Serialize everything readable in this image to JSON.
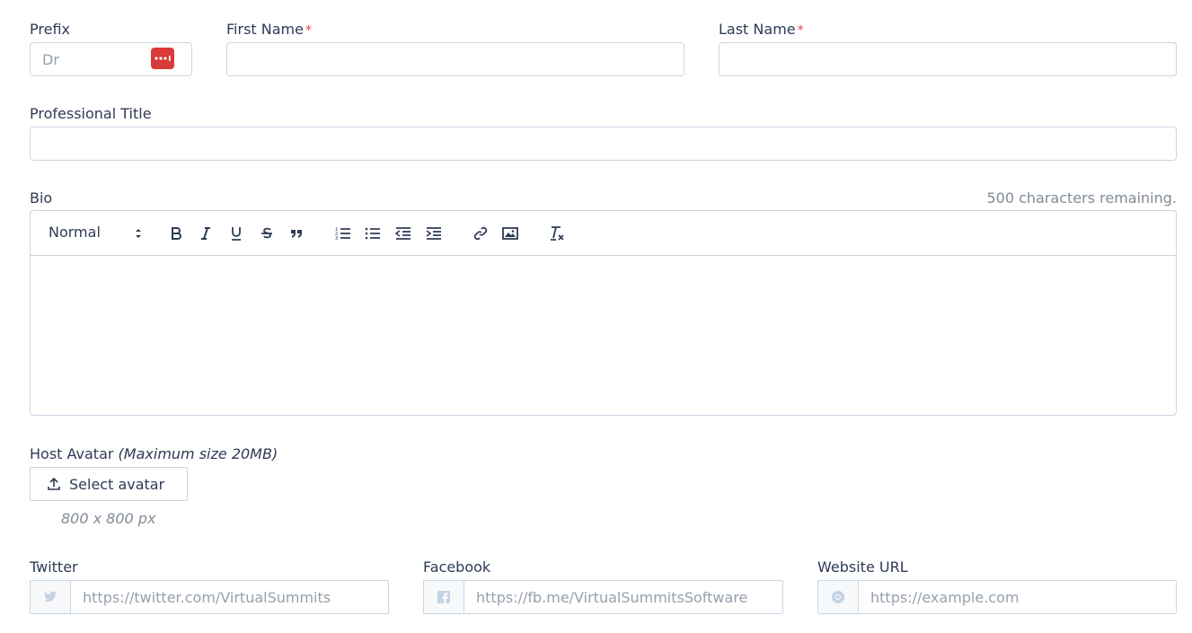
{
  "prefix": {
    "label": "Prefix",
    "placeholder": "Dr"
  },
  "first_name": {
    "label": "First Name",
    "required_mark": "*",
    "value": ""
  },
  "last_name": {
    "label": "Last Name",
    "required_mark": "*",
    "value": ""
  },
  "professional_title": {
    "label": "Professional Title",
    "value": ""
  },
  "bio": {
    "label": "Bio",
    "remaining": "500 characters remaining.",
    "toolbar": {
      "header_select": "Normal",
      "icons": [
        "bold-icon",
        "italic-icon",
        "underline-icon",
        "strike-icon",
        "blockquote-icon",
        "ordered-list-icon",
        "bullet-list-icon",
        "outdent-icon",
        "indent-icon",
        "link-icon",
        "image-icon",
        "clear-format-icon"
      ]
    },
    "value": ""
  },
  "avatar": {
    "label": "Host Avatar",
    "hint": "(Maximum size 20MB)",
    "button_label": "Select avatar",
    "size_note": "800 x 800 px"
  },
  "social": {
    "twitter": {
      "label": "Twitter",
      "placeholder": "https://twitter.com/VirtualSummits"
    },
    "facebook": {
      "label": "Facebook",
      "placeholder": "https://fb.me/VirtualSummitsSoftware"
    },
    "website": {
      "label": "Website URL",
      "placeholder": "https://example.com"
    }
  },
  "colors": {
    "border": "#c9d6e3",
    "required": "#e53e4b",
    "text": "#2e3a55",
    "muted": "#818a96",
    "password_badge": "#d93a3a"
  }
}
